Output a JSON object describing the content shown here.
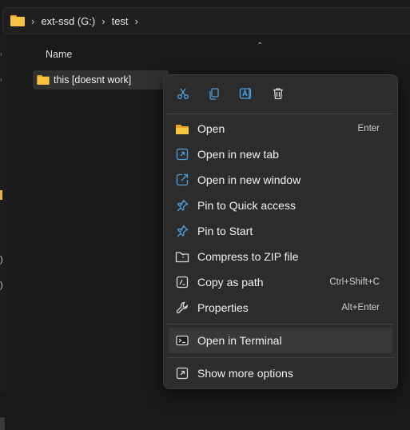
{
  "breadcrumb": [
    "ext-ssd (G:)",
    "test"
  ],
  "column_header": "Name",
  "selected_item": "this [doesnt work]",
  "context_menu": {
    "quick_actions": [
      "cut-icon",
      "copy-icon",
      "rename-icon",
      "delete-icon"
    ],
    "items": [
      {
        "label": "Open",
        "shortcut": "Enter",
        "icon": "folder-open-icon"
      },
      {
        "label": "Open in new tab",
        "shortcut": "",
        "icon": "open-new-tab-icon"
      },
      {
        "label": "Open in new window",
        "shortcut": "",
        "icon": "open-new-window-icon"
      },
      {
        "label": "Pin to Quick access",
        "shortcut": "",
        "icon": "pin-icon"
      },
      {
        "label": "Pin to Start",
        "shortcut": "",
        "icon": "pin-icon"
      },
      {
        "label": "Compress to ZIP file",
        "shortcut": "",
        "icon": "zip-icon"
      },
      {
        "label": "Copy as path",
        "shortcut": "Ctrl+Shift+C",
        "icon": "copy-path-icon"
      },
      {
        "label": "Properties",
        "shortcut": "Alt+Enter",
        "icon": "wrench-icon"
      }
    ],
    "terminal_item": {
      "label": "Open in Terminal",
      "icon": "terminal-icon"
    },
    "more_item": {
      "label": "Show more options",
      "icon": "show-more-icon"
    }
  },
  "colors": {
    "accent_blue": "#4ca0e0",
    "folder_yellow": "#f8c543",
    "menu_bg": "#2c2c2c"
  }
}
